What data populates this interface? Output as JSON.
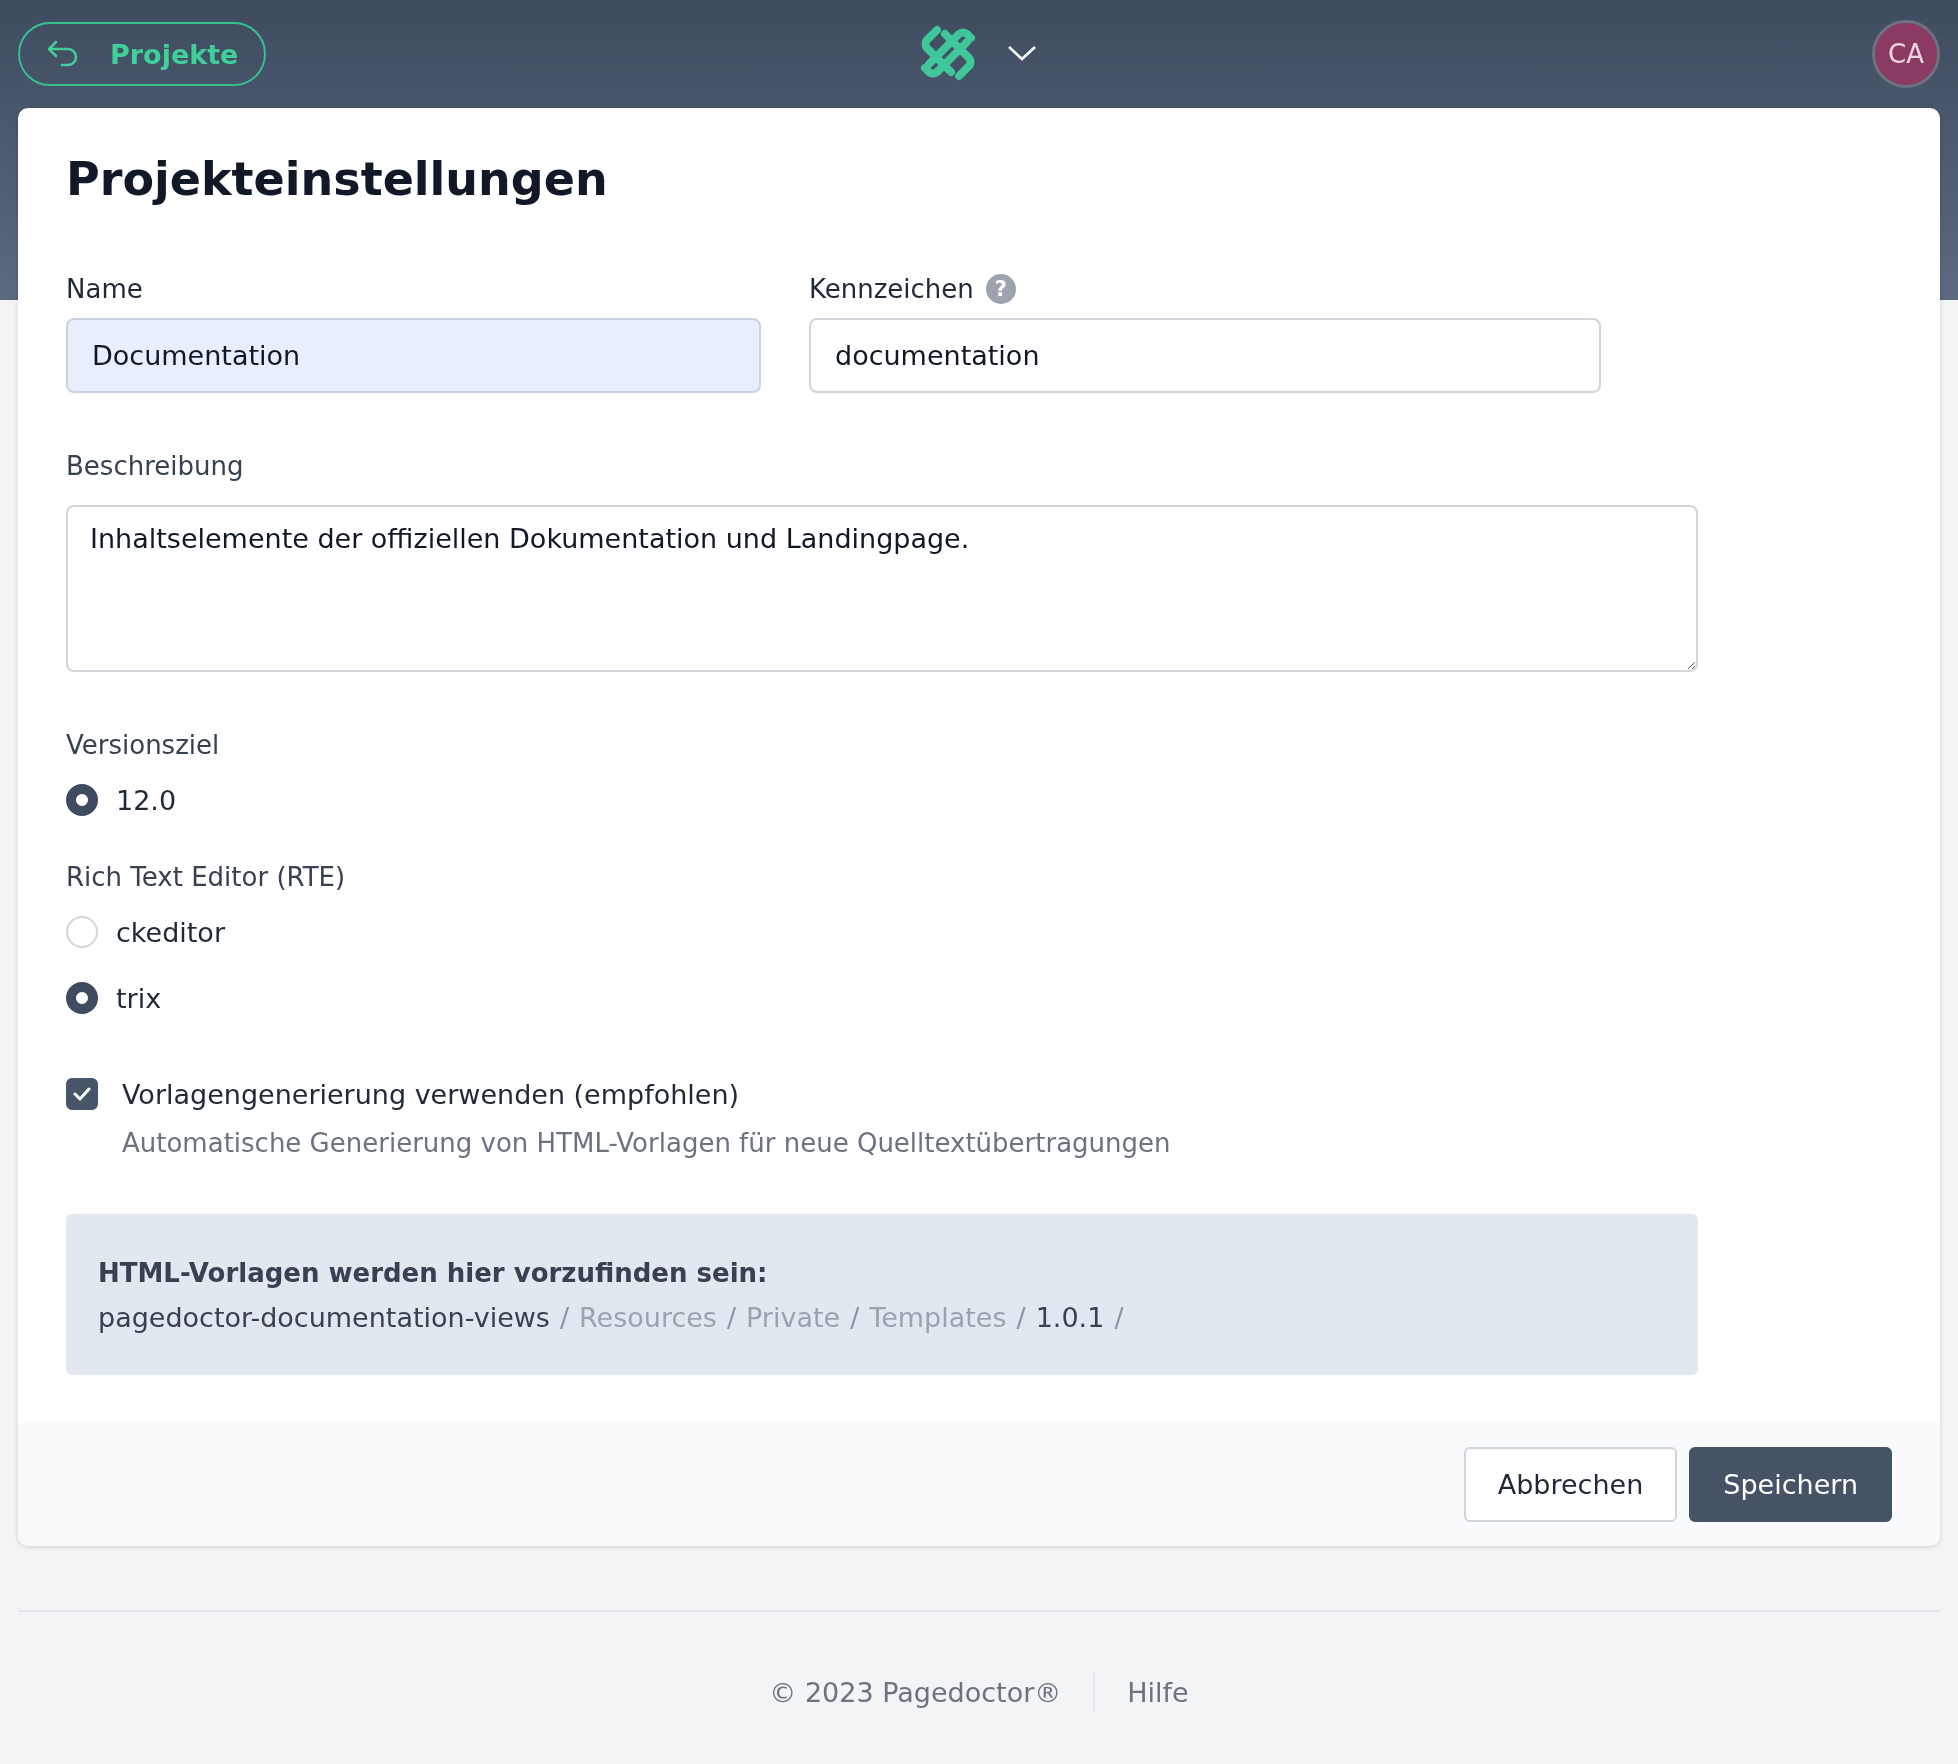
{
  "header": {
    "back_button": {
      "label": "Projekte"
    },
    "avatar": {
      "initials": "CA"
    }
  },
  "title": "Projekteinstellungen",
  "name_field": {
    "label": "Name",
    "value": "Documentation",
    "focused": true
  },
  "key_field": {
    "label": "Kennzeichen",
    "hint": "?",
    "value": "documentation"
  },
  "description": {
    "label": "Beschreibung",
    "value": "Inhaltselemente der offiziellen Dokumentation und Landingpage."
  },
  "version_target": {
    "label": "Versionsziel",
    "options": [
      {
        "label": "12.0",
        "selected": true
      }
    ]
  },
  "rte": {
    "label": "Rich Text Editor (RTE)",
    "options": [
      {
        "label": "ckeditor",
        "selected": false
      },
      {
        "label": "trix",
        "selected": true
      }
    ]
  },
  "template_generation": {
    "label": "Vorlagengenerierung verwenden (empfohlen)",
    "checked": true,
    "help": "Automatische Generierung von HTML-Vorlagen für neue Quelltextübertragungen"
  },
  "info_box": {
    "title": "HTML-Vorlagen werden hier vorzufinden sein:",
    "path": [
      {
        "label": "pagedoctor-documentation-views",
        "separator": "/",
        "kind": "package"
      },
      {
        "label": "Resources",
        "separator": "/",
        "kind": "folder"
      },
      {
        "label": "Private",
        "separator": "/",
        "kind": "folder"
      },
      {
        "label": "Templates",
        "separator": "/",
        "kind": "folder"
      },
      {
        "label": "1.0.1",
        "separator": "/",
        "kind": "version"
      }
    ]
  },
  "buttons": [
    {
      "label": "Abbrechen",
      "kind": "secondary"
    },
    {
      "label": "Speichern",
      "kind": "primary"
    }
  ],
  "footer": {
    "copyright": "© 2023 Pagedoctor®",
    "links": [
      "Hilfe"
    ]
  }
}
